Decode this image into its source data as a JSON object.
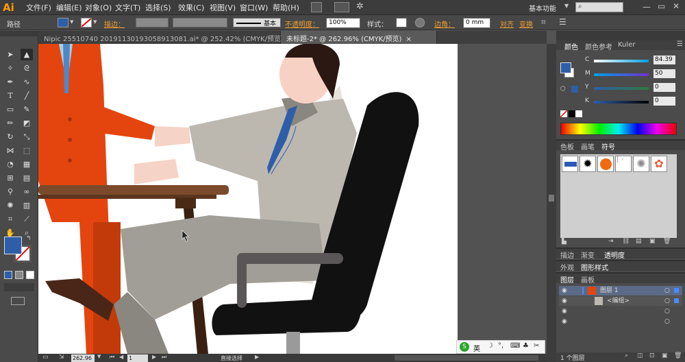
{
  "app": {
    "logo": "Ai"
  },
  "menu": {
    "items": [
      "文件(F)",
      "编辑(E)",
      "对象(O)",
      "文字(T)",
      "选择(S)",
      "效果(C)",
      "视图(V)",
      "窗口(W)",
      "帮助(H)"
    ],
    "workspace": "基本功能"
  },
  "control": {
    "path_label": "路径",
    "stroke_label": "描边：",
    "stroke_style": "基本",
    "opacity_label": "不透明度：",
    "opacity_value": "100%",
    "style_label": "样式：",
    "corner_label": "边角：",
    "corner_value": "0 mm",
    "align_label": "对齐",
    "transform_label": "变换"
  },
  "tabs": [
    {
      "label": "Nipic 25510740 20191130193058913081.ai* @ 252.42% (CMYK/预览)"
    },
    {
      "label": "未标题-2* @ 262.96% (CMYK/预览)"
    }
  ],
  "status": {
    "zoom": "262.96",
    "page": "1",
    "tool": "直接选择"
  },
  "color_panel": {
    "tabs": [
      "颜色",
      "颜色参考",
      "Kuler"
    ],
    "channels": [
      {
        "name": "C",
        "value": "84.39"
      },
      {
        "name": "M",
        "value": "50"
      },
      {
        "name": "Y",
        "value": "0"
      },
      {
        "name": "K",
        "value": "0"
      }
    ],
    "fill_color": "#2e5ea8"
  },
  "swatch_panel": {
    "tabs": [
      "色板",
      "画笔",
      "符号"
    ]
  },
  "stroke_panel": {
    "tabs": [
      "描边",
      "渐变",
      "透明度"
    ]
  },
  "appearance_panel": {
    "tabs": [
      "外观",
      "图形样式"
    ]
  },
  "layers_panel": {
    "tabs": [
      "图层",
      "画板"
    ],
    "rows": [
      {
        "name": "图层 1"
      },
      {
        "name": "<编组>"
      }
    ],
    "count": "1 个图层"
  },
  "ime": {
    "lang": "英"
  }
}
